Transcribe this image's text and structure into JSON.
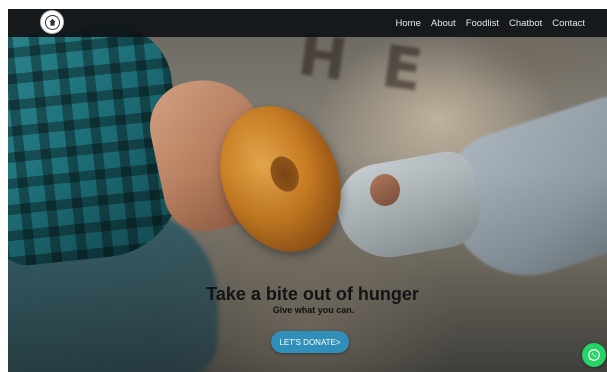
{
  "nav": {
    "logo_icon": "charity-logo-icon",
    "links": [
      "Home",
      "About",
      "Foodlist",
      "Chatbot",
      "Contact"
    ]
  },
  "hero": {
    "title": "Take a bite out of hunger",
    "subtitle": "Give what you can.",
    "cta_label": "LET'S DONATE>"
  },
  "floating": {
    "whatsapp_icon": "whatsapp-icon"
  },
  "colors": {
    "navbar": "#0f1216",
    "nav_text": "#dfe8ee",
    "cta": "#2f8fb8",
    "whatsapp": "#25d366"
  }
}
